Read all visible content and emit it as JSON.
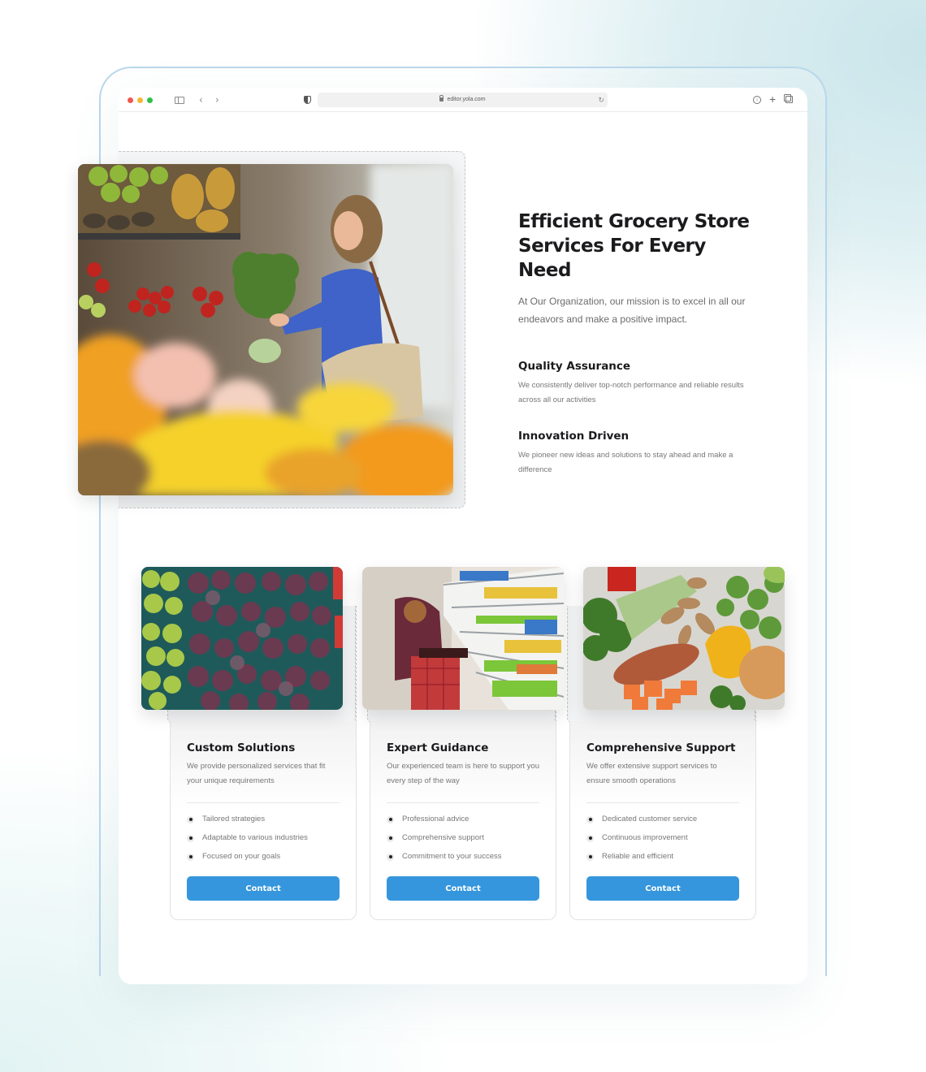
{
  "browser": {
    "url": "editor.yola.com",
    "icons": [
      "sidebar-icon",
      "back-icon",
      "forward-icon",
      "shield-icon",
      "lock-icon",
      "reload-icon",
      "download-icon",
      "new-tab-icon",
      "tabs-icon"
    ]
  },
  "hero": {
    "image_alt": "Woman in blue sweater choosing greens at a fruit market stall",
    "title": "Efficient Grocery Store Services For Every Need",
    "lead": "At Our Organization, our mission is to excel in all our endeavors and make a positive impact.",
    "features": [
      {
        "title": "Quality Assurance",
        "description": "We consistently deliver top-notch performance and reliable results across all our activities"
      },
      {
        "title": "Innovation Driven",
        "description": "We pioneer new ideas and solutions to stay ahead and make a difference"
      }
    ]
  },
  "services": [
    {
      "image_alt": "Crates of green pears and purple figs",
      "title": "Custom Solutions",
      "description": "We provide personalized services that fit your unique requirements",
      "bullets": [
        "Tailored strategies",
        "Adaptable to various industries",
        "Focused on your goals"
      ],
      "button": "Contact"
    },
    {
      "image_alt": "Shopper with a plaid trolley bag in a supermarket aisle",
      "title": "Expert Guidance",
      "description": "Our experienced team is here to support you every step of the way",
      "bullets": [
        "Professional advice",
        "Comprehensive support",
        "Commitment to your success"
      ],
      "button": "Contact"
    },
    {
      "image_alt": "Fresh vegetables: broccoli, sweet potato, yellow pepper, onion",
      "title": "Comprehensive Support",
      "description": "We offer extensive support services to ensure smooth operations",
      "bullets": [
        "Dedicated customer service",
        "Continuous improvement",
        "Reliable and efficient"
      ],
      "button": "Contact"
    }
  ],
  "colors": {
    "accent": "#3596dd",
    "heading": "#1b1b1e",
    "body_text": "#777777",
    "frame_border": "#b9d8ec"
  }
}
